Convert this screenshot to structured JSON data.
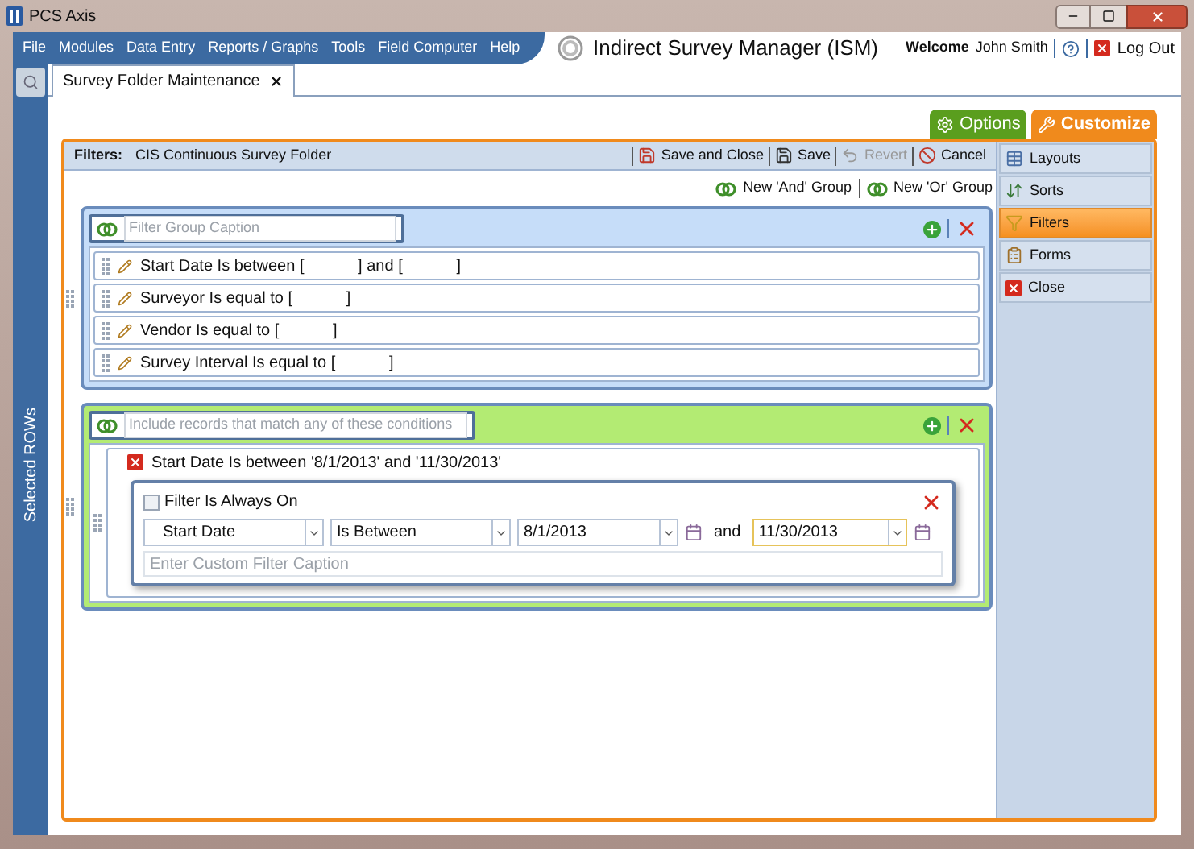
{
  "window": {
    "title": "PCS Axis"
  },
  "menu": [
    "File",
    "Modules",
    "Data Entry",
    "Reports / Graphs",
    "Tools",
    "Field Computer",
    "Help"
  ],
  "app_title": "Indirect Survey Manager (ISM)",
  "user": {
    "welcome": "Welcome",
    "name": "John Smith",
    "logout": "Log Out"
  },
  "side_tab": {
    "label": "Selected ROWs"
  },
  "tabs": [
    {
      "label": "Survey Folder Maintenance",
      "selected": true
    }
  ],
  "mode_tabs": [
    {
      "label": "Options",
      "selected": false,
      "color": "#5a9e1e"
    },
    {
      "label": "Customize",
      "selected": true,
      "color": "#f08a1c"
    }
  ],
  "toolbar": {
    "label": "Filters:",
    "folder": "CIS Continuous Survey Folder",
    "buttons": [
      {
        "kind": "save-close",
        "label": "Save and Close",
        "disabled": false
      },
      {
        "kind": "save",
        "label": "Save",
        "disabled": false
      },
      {
        "kind": "revert",
        "label": "Revert",
        "disabled": true
      },
      {
        "kind": "cancel",
        "label": "Cancel",
        "disabled": false
      }
    ]
  },
  "group_actions": [
    "New 'And' Group",
    "New 'Or' Group"
  ],
  "groups": [
    {
      "kind": "and",
      "placeholder": "Filter Group Caption",
      "conditions": [
        {
          "text": "Start Date Is between [            ] and [            ]",
          "expanded": false
        },
        {
          "text": "Surveyor Is equal to [            ]",
          "expanded": false
        },
        {
          "text": "Vendor Is equal to [            ]",
          "expanded": false
        },
        {
          "text": "Survey Interval Is equal to [            ]",
          "expanded": false
        }
      ]
    },
    {
      "kind": "or",
      "placeholder": "Include records that match any of these conditions",
      "conditions": [
        {
          "text": "Start Date Is between '8/1/2013' and '11/30/2013'",
          "expanded": true,
          "editor": {
            "always_on": {
              "label": "Filter Is Always On",
              "checked": false
            },
            "field": "Start Date",
            "operator": "Is Between",
            "from": "8/1/2013",
            "joiner": "and",
            "to": "11/30/2013",
            "to_focused": true,
            "caption_placeholder": "Enter Custom Filter Caption"
          }
        }
      ]
    }
  ],
  "nav": [
    {
      "kind": "layouts",
      "label": "Layouts",
      "selected": false
    },
    {
      "kind": "sorts",
      "label": "Sorts",
      "selected": false
    },
    {
      "kind": "filters",
      "label": "Filters",
      "selected": true
    },
    {
      "kind": "forms",
      "label": "Forms",
      "selected": false
    },
    {
      "kind": "close",
      "label": "Close",
      "selected": false
    }
  ]
}
